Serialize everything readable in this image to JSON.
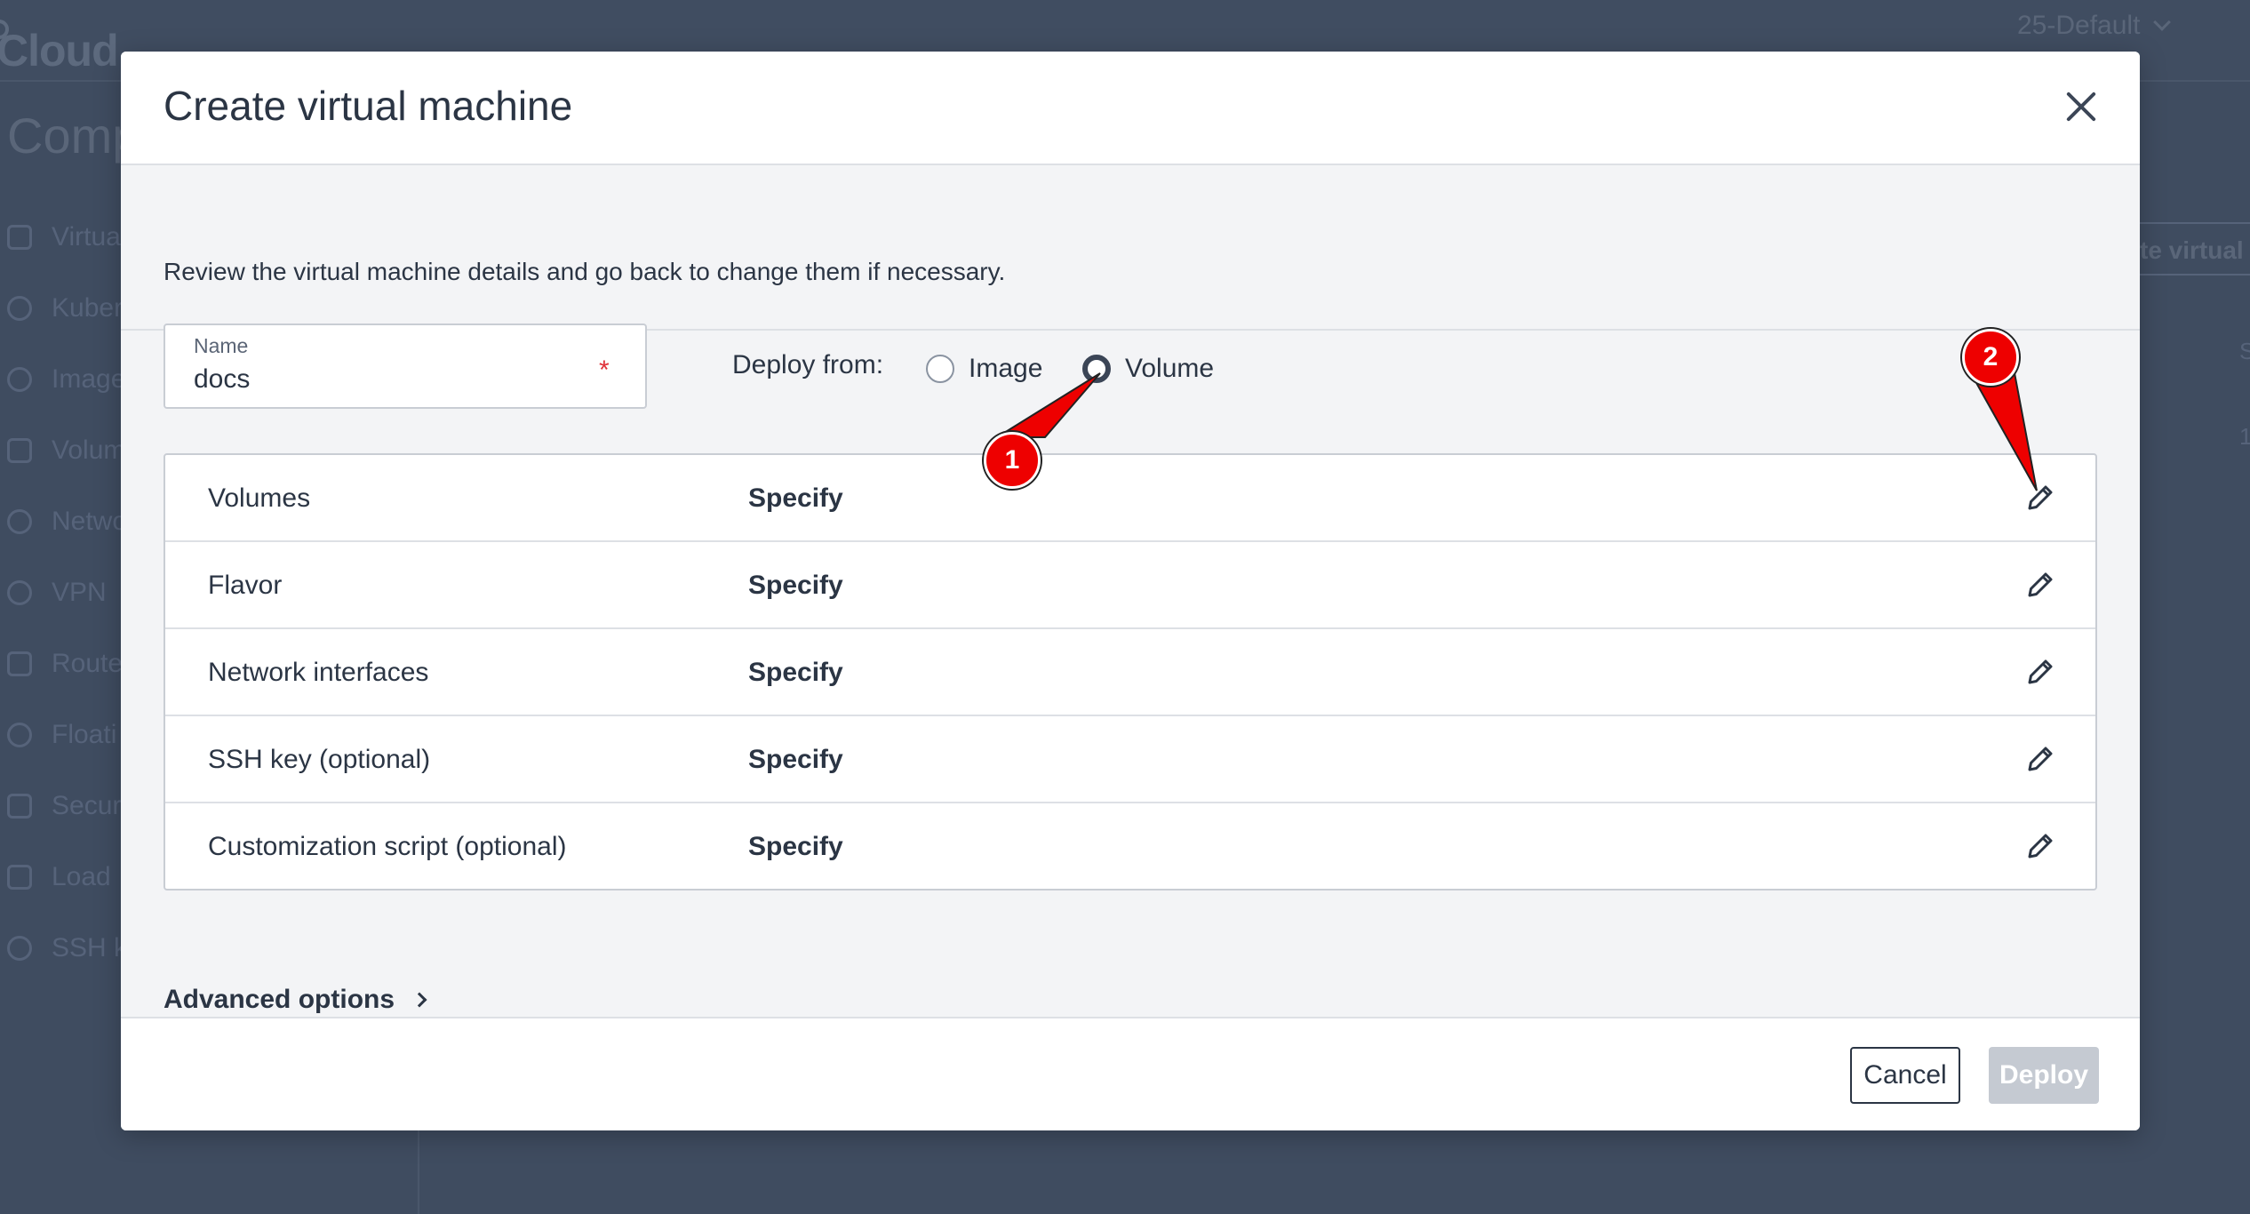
{
  "background": {
    "logo_text": "Cloud",
    "project_selector": "25-Default",
    "page_heading": "Comp",
    "nav_items": [
      "Virtua",
      "Kuber",
      "Image",
      "Volum",
      "Netwo",
      "VPN",
      "Route",
      "Floati",
      "Secur",
      "Load",
      "SSH k"
    ],
    "create_button_fragment": "te virtual",
    "side_fragment_1": "S",
    "side_fragment_2": "1"
  },
  "modal": {
    "title": "Create virtual machine",
    "description": "Review the virtual machine details and go back to change them if necessary.",
    "name_field": {
      "label": "Name",
      "value": "docs",
      "required_mark": "*"
    },
    "deploy_from": {
      "label": "Deploy from:",
      "options": [
        {
          "label": "Image",
          "selected": false
        },
        {
          "label": "Volume",
          "selected": true
        }
      ]
    },
    "config_rows": [
      {
        "label": "Volumes",
        "value": "Specify"
      },
      {
        "label": "Flavor",
        "value": "Specify"
      },
      {
        "label": "Network interfaces",
        "value": "Specify"
      },
      {
        "label": "SSH key (optional)",
        "value": "Specify"
      },
      {
        "label": "Customization script (optional)",
        "value": "Specify"
      }
    ],
    "advanced_options_label": "Advanced options",
    "footer": {
      "cancel_label": "Cancel",
      "deploy_label": "Deploy"
    }
  },
  "annotations": [
    {
      "number": "1"
    },
    {
      "number": "2"
    }
  ],
  "colors": {
    "annotation_red": "#ee0000",
    "overlay": "#3f4c60",
    "text_primary": "#2b3544",
    "deploy_disabled": "#c5cad2"
  },
  "icons": {
    "close": "close-icon",
    "edit": "pencil-icon",
    "advanced": "chevron-right-icon"
  }
}
